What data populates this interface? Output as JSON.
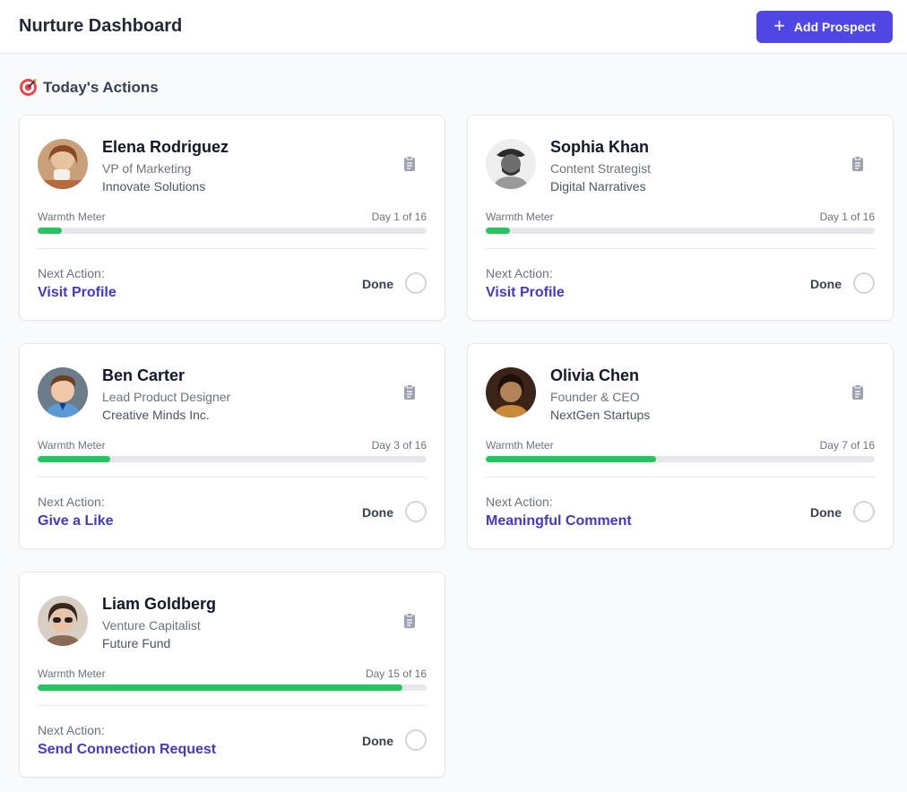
{
  "header": {
    "title": "Nurture Dashboard",
    "add_button_label": "Add Prospect"
  },
  "section": {
    "title": "Today's Actions"
  },
  "labels": {
    "warmth": "Warmth Meter",
    "next_action": "Next Action:",
    "done": "Done"
  },
  "prospects": [
    {
      "name": "Elena Rodriguez",
      "role": "VP of Marketing",
      "company": "Innovate Solutions",
      "day_text": "Day 1 of 16",
      "warmth": 0.0625,
      "next_action": "Visit Profile"
    },
    {
      "name": "Sophia Khan",
      "role": "Content Strategist",
      "company": "Digital Narratives",
      "day_text": "Day 1 of 16",
      "warmth": 0.0625,
      "next_action": "Visit Profile"
    },
    {
      "name": "Ben Carter",
      "role": "Lead Product Designer",
      "company": "Creative Minds Inc.",
      "day_text": "Day 3 of 16",
      "warmth": 0.1875,
      "next_action": "Give a Like"
    },
    {
      "name": "Olivia Chen",
      "role": "Founder & CEO",
      "company": "NextGen Startups",
      "day_text": "Day 7 of 16",
      "warmth": 0.4375,
      "next_action": "Meaningful Comment"
    },
    {
      "name": "Liam Goldberg",
      "role": "Venture Capitalist",
      "company": "Future Fund",
      "day_text": "Day 15 of 16",
      "warmth": 0.9375,
      "next_action": "Send Connection Request"
    }
  ],
  "colors": {
    "accent": "#4f46e5",
    "link": "#4338ca",
    "warmth_fill": "#22c55e",
    "track": "#e5e7eb"
  }
}
